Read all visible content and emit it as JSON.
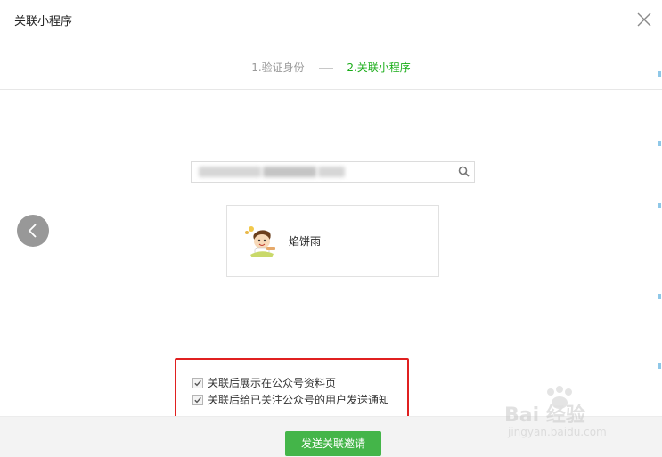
{
  "dialog": {
    "title": "关联小程序",
    "close_icon": "close-icon"
  },
  "steps": [
    {
      "label": "1.验证身份",
      "state": "done"
    },
    {
      "label": "2.关联小程序",
      "state": "active"
    }
  ],
  "search": {
    "value": "",
    "placeholder": "",
    "icon": "search-icon"
  },
  "result_card": {
    "name": "焰饼雨",
    "avatar_icon": "cartoon-boy-avatar"
  },
  "options": [
    {
      "label": "关联后展示在公众号资料页",
      "checked": true
    },
    {
      "label": "关联后给已关注公众号的用户发送通知",
      "checked": true
    }
  ],
  "footer": {
    "send_label": "发送关联邀请"
  },
  "watermark": {
    "text": "Bai 经验",
    "sub": "jingyan.baidu.com"
  },
  "colors": {
    "accent_green": "#1aad19",
    "button_green": "#44b549",
    "highlight_red": "#e02020"
  }
}
